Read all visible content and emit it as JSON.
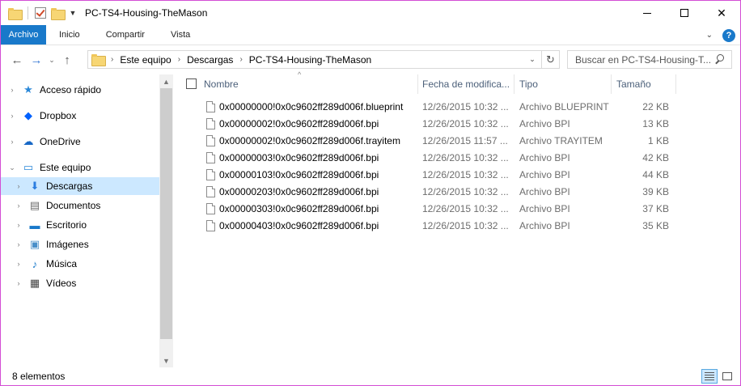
{
  "window": {
    "title": "PC-TS4-Housing-TheMason",
    "controls": {
      "minimize": "",
      "maximize": "",
      "close": "✕"
    }
  },
  "ribbon": {
    "tabs": [
      {
        "label": "Archivo",
        "active": true
      },
      {
        "label": "Inicio"
      },
      {
        "label": "Compartir"
      },
      {
        "label": "Vista"
      }
    ],
    "help_label": "?",
    "expand_icon": "chevron-down-icon"
  },
  "nav": {
    "back_icon": "←",
    "forward_icon": "→",
    "recent_icon": "⌄",
    "up_icon": "↑",
    "breadcrumb": [
      "Este equipo",
      "Descargas",
      "PC-TS4-Housing-TheMason"
    ],
    "separator": "›",
    "refresh_icon": "↻",
    "search_placeholder": "Buscar en PC-TS4-Housing-T..."
  },
  "sidebar": {
    "items": [
      {
        "label": "Acceso rápido",
        "icon": "star-icon",
        "glyph": "★",
        "color": "#2b88d8"
      },
      {
        "label": "Dropbox",
        "icon": "dropbox-icon",
        "glyph": "◆",
        "color": "#0061fe"
      },
      {
        "label": "OneDrive",
        "icon": "cloud-icon",
        "glyph": "☁",
        "color": "#1768c6"
      },
      {
        "label": "Este equipo",
        "icon": "computer-icon",
        "glyph": "▭",
        "color": "#2b88d8"
      },
      {
        "label": "Descargas",
        "icon": "download-icon",
        "glyph": "⬇",
        "color": "#2b7de0"
      },
      {
        "label": "Documentos",
        "icon": "document-icon",
        "glyph": "▤",
        "color": "#6b6b6b"
      },
      {
        "label": "Escritorio",
        "icon": "desktop-icon",
        "glyph": "▬",
        "color": "#1979ca"
      },
      {
        "label": "Imágenes",
        "icon": "image-icon",
        "glyph": "▣",
        "color": "#4a8fc9"
      },
      {
        "label": "Música",
        "icon": "music-icon",
        "glyph": "♪",
        "color": "#1979ca"
      },
      {
        "label": "Vídeos",
        "icon": "video-icon",
        "glyph": "▦",
        "color": "#444444"
      }
    ],
    "expand_glyph": "›",
    "expanded_glyph": "⌄"
  },
  "files": {
    "columns": {
      "name": "Nombre",
      "date": "Fecha de modifica...",
      "type": "Tipo",
      "size": "Tamaño"
    },
    "sort_indicator": "^",
    "rows": [
      {
        "name": "0x00000000!0x0c9602ff289d006f.blueprint",
        "date": "12/26/2015 10:32 ...",
        "type": "Archivo BLUEPRINT",
        "size": "22 KB"
      },
      {
        "name": "0x00000002!0x0c9602ff289d006f.bpi",
        "date": "12/26/2015 10:32 ...",
        "type": "Archivo BPI",
        "size": "13 KB"
      },
      {
        "name": "0x00000002!0x0c9602ff289d006f.trayitem",
        "date": "12/26/2015 11:57 ...",
        "type": "Archivo TRAYITEM",
        "size": "1 KB"
      },
      {
        "name": "0x00000003!0x0c9602ff289d006f.bpi",
        "date": "12/26/2015 10:32 ...",
        "type": "Archivo BPI",
        "size": "42 KB"
      },
      {
        "name": "0x00000103!0x0c9602ff289d006f.bpi",
        "date": "12/26/2015 10:32 ...",
        "type": "Archivo BPI",
        "size": "44 KB"
      },
      {
        "name": "0x00000203!0x0c9602ff289d006f.bpi",
        "date": "12/26/2015 10:32 ...",
        "type": "Archivo BPI",
        "size": "39 KB"
      },
      {
        "name": "0x00000303!0x0c9602ff289d006f.bpi",
        "date": "12/26/2015 10:32 ...",
        "type": "Archivo BPI",
        "size": "37 KB"
      },
      {
        "name": "0x00000403!0x0c9602ff289d006f.bpi",
        "date": "12/26/2015 10:32 ...",
        "type": "Archivo BPI",
        "size": "35 KB"
      }
    ]
  },
  "status": {
    "text": "8 elementos"
  }
}
